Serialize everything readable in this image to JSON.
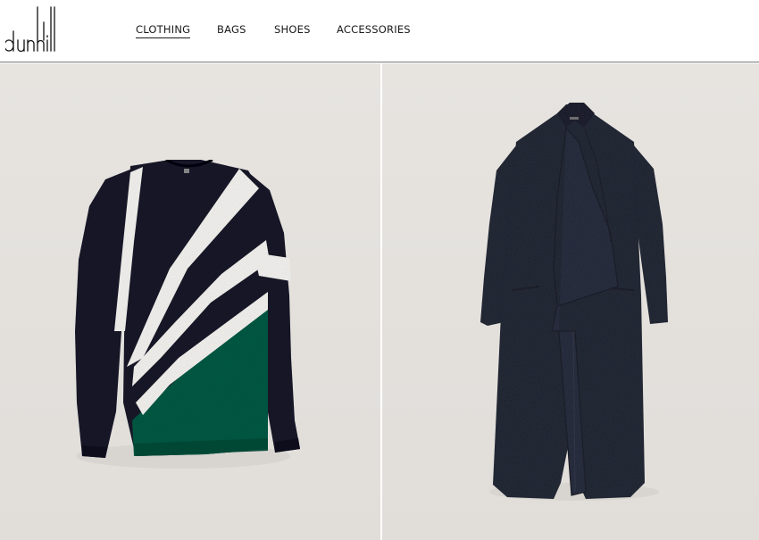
{
  "brand": {
    "logo_text": "dunhill"
  },
  "nav": {
    "items": [
      {
        "label": "CLOTHING",
        "active": true
      },
      {
        "label": "BAGS",
        "active": false
      },
      {
        "label": "SHOES",
        "active": false
      },
      {
        "label": "ACCESSORIES",
        "active": false
      }
    ]
  },
  "gallery": {
    "products": [
      {
        "image": "striped-knit-sweater",
        "colors": [
          "#1b1e2b",
          "#f4f3f0",
          "#0f5a44"
        ]
      },
      {
        "image": "long-black-coat",
        "colors": [
          "#161a26"
        ]
      }
    ]
  },
  "theme": {
    "header_border": "#7a7a7a",
    "panel_background": "#e5e2de"
  }
}
